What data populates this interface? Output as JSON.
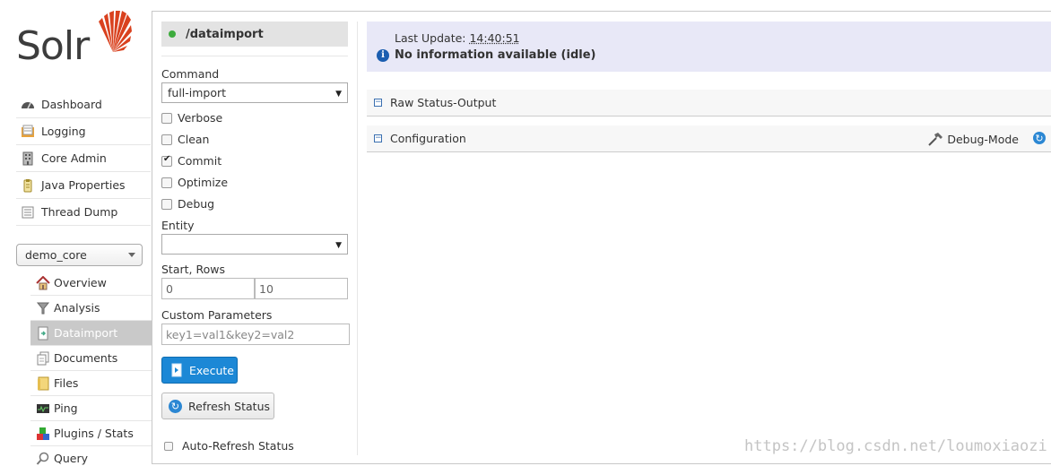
{
  "logo": {
    "text": "Solr"
  },
  "nav": [
    {
      "label": "Dashboard",
      "icon": "dashboard-icon"
    },
    {
      "label": "Logging",
      "icon": "logging-icon"
    },
    {
      "label": "Core Admin",
      "icon": "core-admin-icon"
    },
    {
      "label": "Java Properties",
      "icon": "java-properties-icon"
    },
    {
      "label": "Thread Dump",
      "icon": "thread-dump-icon"
    }
  ],
  "core_selector": {
    "value": "demo_core"
  },
  "core_nav": [
    {
      "label": "Overview",
      "icon": "home-icon"
    },
    {
      "label": "Analysis",
      "icon": "filter-icon"
    },
    {
      "label": "Dataimport",
      "icon": "dataimport-icon",
      "active": true
    },
    {
      "label": "Documents",
      "icon": "documents-icon"
    },
    {
      "label": "Files",
      "icon": "folder-icon"
    },
    {
      "label": "Ping",
      "icon": "ping-icon"
    },
    {
      "label": "Plugins / Stats",
      "icon": "plugins-icon"
    },
    {
      "label": "Query",
      "icon": "search-icon"
    }
  ],
  "form": {
    "handler": "/dataimport",
    "command_label": "Command",
    "command_value": "full-import",
    "options": [
      {
        "label": "Verbose",
        "checked": false
      },
      {
        "label": "Clean",
        "checked": false
      },
      {
        "label": "Commit",
        "checked": true
      },
      {
        "label": "Optimize",
        "checked": false
      },
      {
        "label": "Debug",
        "checked": false
      }
    ],
    "entity_label": "Entity",
    "entity_value": "",
    "start_rows_label": "Start, Rows",
    "start_value": "0",
    "rows_value": "10",
    "custom_params_label": "Custom Parameters",
    "custom_params_placeholder": "key1=val1&key2=val2",
    "execute_label": "Execute",
    "refresh_label": "Refresh Status",
    "auto_refresh_label": "Auto-Refresh Status"
  },
  "status": {
    "last_update_label": "Last Update:",
    "last_update_time": "14:40:51",
    "message": "No information available (idle)"
  },
  "sections": {
    "raw_status": "Raw Status-Output",
    "configuration": "Configuration",
    "debug_mode": "Debug-Mode"
  },
  "watermark": "https://blog.csdn.net/loumoxiaozi",
  "colors": {
    "accent": "#1c88d6",
    "status_bg": "#e8e8f7",
    "active_nav": "#c9c9c9",
    "status_dot": "#3dab3d"
  }
}
